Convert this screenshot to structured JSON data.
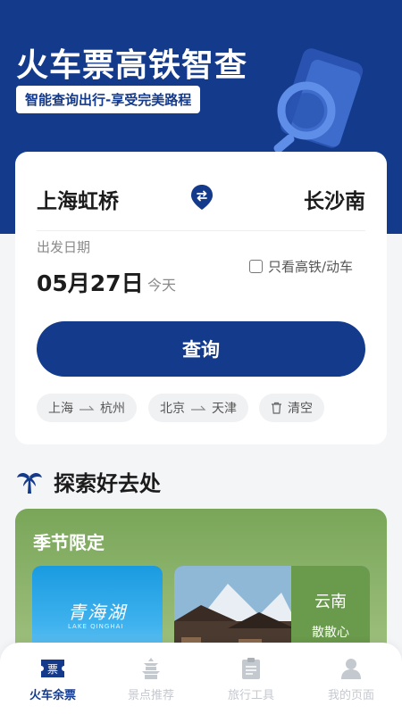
{
  "hero": {
    "title": "火车票高铁智查",
    "subtitle": "智能查询出行-享受完美路程"
  },
  "search": {
    "from_station": "上海虹桥",
    "to_station": "长沙南",
    "date_label": "出发日期",
    "date_value": "05月27日",
    "date_hint": "今天",
    "high_speed_only_label": "只看高铁/动车",
    "high_speed_only_checked": false,
    "query_button": "查询",
    "history": [
      {
        "from": "上海",
        "to": "杭州"
      },
      {
        "from": "北京",
        "to": "天津"
      }
    ],
    "clear_label": "清空"
  },
  "explore": {
    "title": "探索好去处"
  },
  "seasonal": {
    "title": "季节限定",
    "destinations": [
      {
        "name": "青海湖",
        "name_en": "LAKE QINGHAI"
      },
      {
        "name": "云南",
        "subtitle": "散散心"
      }
    ]
  },
  "tabbar": {
    "items": [
      {
        "label": "火车余票",
        "icon": "ticket-icon",
        "active": true
      },
      {
        "label": "景点推荐",
        "icon": "pagoda-icon",
        "active": false
      },
      {
        "label": "旅行工具",
        "icon": "clipboard-icon",
        "active": false
      },
      {
        "label": "我的页面",
        "icon": "user-icon",
        "active": false
      }
    ]
  },
  "colors": {
    "primary": "#143a8c",
    "season_green": "#79a659",
    "inactive_tab": "#c4c8cf"
  }
}
